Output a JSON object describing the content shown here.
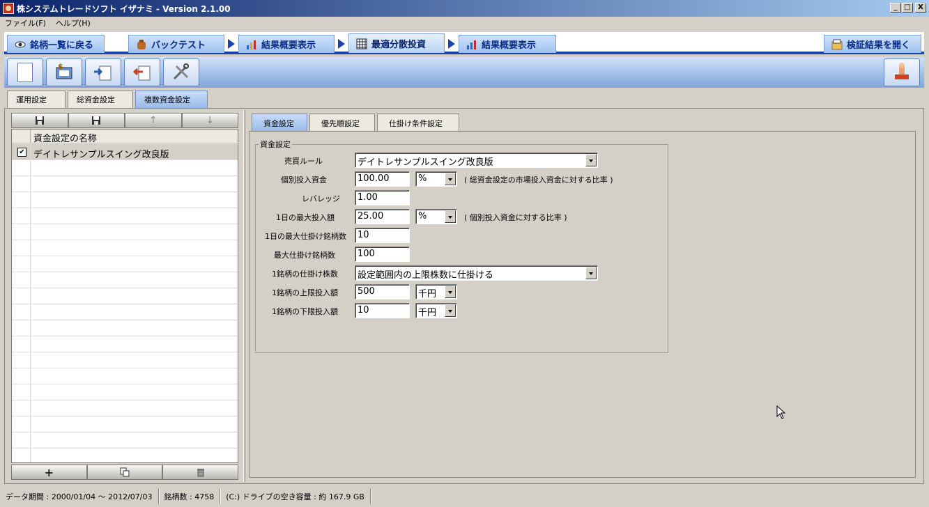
{
  "window": {
    "title": "株システムトレードソフト イザナミ - Version 2.1.00",
    "controls": [
      "_",
      "□",
      "X"
    ]
  },
  "menu": [
    "ファイル(F)",
    "ヘルプ(H)"
  ],
  "nav": {
    "tabs": [
      {
        "label": "銘柄一覧に戻る",
        "icon": "eye-icon"
      },
      {
        "label": "バックテスト",
        "icon": "bag-icon"
      },
      {
        "label": "結果概要表示",
        "icon": "chart-icon"
      },
      {
        "label": "最適分散投資",
        "icon": "grid-icon"
      },
      {
        "label": "結果概要表示",
        "icon": "bar-chart-icon"
      }
    ],
    "right_button": "検証結果を開く",
    "active_index": 3
  },
  "toolbar": {
    "buttons": [
      "new-document-icon",
      "money-calculator-icon",
      "export-icon",
      "import-icon",
      "tools-icon"
    ],
    "right_button": "stamp-icon"
  },
  "subtabs": {
    "items": [
      "運用設定",
      "総資金設定",
      "複数資金設定"
    ],
    "active_index": 2
  },
  "left_panel": {
    "toolbar_icons": [
      "save-icon",
      "save-as-icon",
      "move-up-icon",
      "move-down-icon"
    ],
    "grid": {
      "header": "資金設定の名称",
      "rows": [
        {
          "checked": true,
          "name": "デイトレサンプルスイング改良版"
        }
      ]
    },
    "bottom_icons": [
      "add-icon",
      "copy-icon",
      "delete-icon"
    ]
  },
  "inner_tabs": {
    "items": [
      "資金設定",
      "優先順設定",
      "仕掛け条件設定"
    ],
    "active_index": 0
  },
  "form": {
    "group_title": "資金設定",
    "fields": {
      "trade_rule": {
        "label": "売買ルール",
        "value": "デイトレサンプルスイング改良版"
      },
      "individual_capital": {
        "label": "個別投入資金",
        "value": "100.00",
        "unit": "%",
        "note": "( 総資金設定の市場投入資金に対する比率 )"
      },
      "leverage": {
        "label": "レバレッジ",
        "value": "1.00"
      },
      "daily_max": {
        "label": "1日の最大投入額",
        "value": "25.00",
        "unit": "%",
        "note": "( 個別投入資金に対する比率 )"
      },
      "daily_max_stocks": {
        "label": "1日の最大仕掛け銘柄数",
        "value": "10"
      },
      "max_stocks": {
        "label": "最大仕掛け銘柄数",
        "value": "100"
      },
      "shares_per_stock": {
        "label": "1銘柄の仕掛け株数",
        "value": "設定範囲内の上限株数に仕掛ける"
      },
      "upper_limit": {
        "label": "1銘柄の上限投入額",
        "value": "500",
        "unit": "千円"
      },
      "lower_limit": {
        "label": "1銘柄の下限投入額",
        "value": "10",
        "unit": "千円"
      }
    }
  },
  "statusbar": {
    "data_period": "データ期間 : 2000/01/04 〜 2012/07/03",
    "stock_count": "銘柄数 : 4758",
    "drive_space": "(C:) ドライブの空き容量 : 約 167.9 GB"
  }
}
